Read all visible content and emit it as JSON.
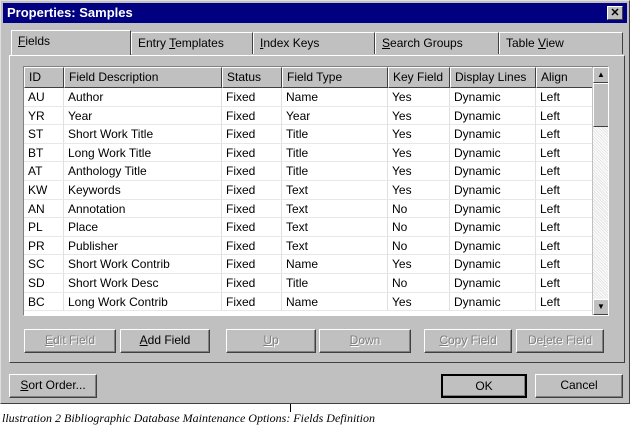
{
  "window": {
    "title": "Properties: Samples",
    "close_glyph": "✕"
  },
  "tabs": [
    {
      "mnemonic": "F",
      "rest": "ields",
      "active": true
    },
    {
      "label_pre": "Entry ",
      "mnemonic": "T",
      "rest": "emplates"
    },
    {
      "mnemonic": "I",
      "rest": "ndex Keys"
    },
    {
      "mnemonic": "S",
      "rest": "earch Groups"
    },
    {
      "label_pre": "Table ",
      "mnemonic": "V",
      "rest": "iew"
    }
  ],
  "grid": {
    "columns": [
      "ID",
      "Field Description",
      "Status",
      "Field Type",
      "Key Field",
      "Display Lines",
      "Align"
    ],
    "rows": [
      [
        "AU",
        "Author",
        "Fixed",
        "Name",
        "Yes",
        "Dynamic",
        "Left"
      ],
      [
        "YR",
        "Year",
        "Fixed",
        "Year",
        "Yes",
        "Dynamic",
        "Left"
      ],
      [
        "ST",
        "Short Work Title",
        "Fixed",
        "Title",
        "Yes",
        "Dynamic",
        "Left"
      ],
      [
        "BT",
        "Long Work Title",
        "Fixed",
        "Title",
        "Yes",
        "Dynamic",
        "Left"
      ],
      [
        "AT",
        "Anthology Title",
        "Fixed",
        "Title",
        "Yes",
        "Dynamic",
        "Left"
      ],
      [
        "KW",
        "Keywords",
        "Fixed",
        "Text",
        "Yes",
        "Dynamic",
        "Left"
      ],
      [
        "AN",
        "Annotation",
        "Fixed",
        "Text",
        "No",
        "Dynamic",
        "Left"
      ],
      [
        "PL",
        "Place",
        "Fixed",
        "Text",
        "No",
        "Dynamic",
        "Left"
      ],
      [
        "PR",
        "Publisher",
        "Fixed",
        "Text",
        "No",
        "Dynamic",
        "Left"
      ],
      [
        "SC",
        "Short Work Contrib",
        "Fixed",
        "Name",
        "Yes",
        "Dynamic",
        "Left"
      ],
      [
        "SD",
        "Short Work Desc",
        "Fixed",
        "Title",
        "No",
        "Dynamic",
        "Left"
      ],
      [
        "BC",
        "Long Work Contrib",
        "Fixed",
        "Name",
        "Yes",
        "Dynamic",
        "Left"
      ]
    ]
  },
  "field_buttons": [
    {
      "name": "edit-field-button",
      "mnemonic": "E",
      "rest": "dit Field",
      "enabled": false
    },
    {
      "name": "add-field-button",
      "mnemonic": "A",
      "rest": "dd Field",
      "enabled": true
    },
    {
      "name": "up-button",
      "mnemonic": "U",
      "rest": "p",
      "enabled": false
    },
    {
      "name": "down-button",
      "mnemonic": "D",
      "rest": "own",
      "enabled": false
    },
    {
      "name": "copy-field-button",
      "mnemonic": "C",
      "rest": "opy Field",
      "enabled": false
    },
    {
      "name": "delete-field-button",
      "pre": "De",
      "mnemonic": "l",
      "rest": "ete Field",
      "enabled": false
    }
  ],
  "bottom_buttons": {
    "sort_order": {
      "mnemonic": "S",
      "rest": "ort Order..."
    },
    "ok": "OK",
    "cancel": "Cancel"
  },
  "caption": "llustration 2 Bibliographic Database Maintenance Options: Fields Definition"
}
